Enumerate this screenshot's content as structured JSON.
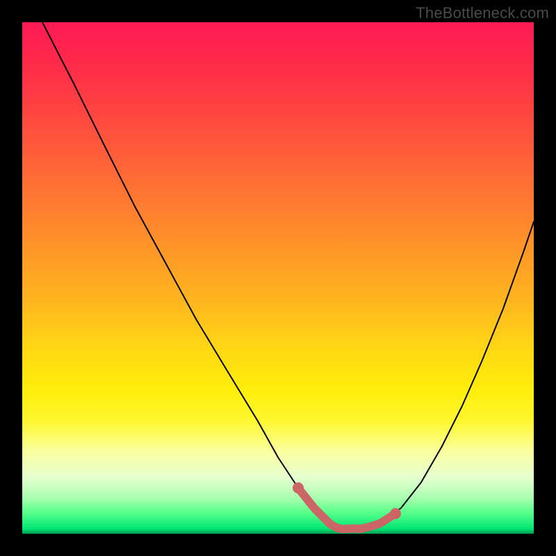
{
  "watermark": "TheBottleneck.com",
  "colors": {
    "frame": "#000000",
    "curve": "#000000",
    "highlight": "#cc6666",
    "gradient_top": "#ff1a55",
    "gradient_bottom": "#00e676"
  },
  "chart_data": {
    "type": "line",
    "title": "",
    "xlabel": "",
    "ylabel": "",
    "xlim": [
      0,
      100
    ],
    "ylim": [
      0,
      100
    ],
    "series": [
      {
        "name": "bottleneck-curve",
        "x": [
          4,
          10,
          16,
          22,
          28,
          34,
          40,
          46,
          50,
          54,
          57,
          60,
          63,
          66,
          70,
          74,
          78,
          82,
          86,
          90,
          94,
          98,
          100
        ],
        "y": [
          100,
          88,
          76,
          64,
          53,
          42,
          32,
          22,
          15,
          9,
          5,
          2,
          1,
          1,
          2,
          5,
          10,
          17,
          25,
          34,
          44,
          55,
          61
        ]
      }
    ],
    "highlight": {
      "name": "optimal-range",
      "x": [
        54,
        57,
        60,
        63,
        66,
        70,
        73
      ],
      "y": [
        9,
        5,
        2,
        1,
        1,
        2,
        4
      ]
    },
    "annotations": [
      {
        "text": "TheBottleneck.com",
        "role": "watermark",
        "position": "top-right"
      }
    ]
  }
}
